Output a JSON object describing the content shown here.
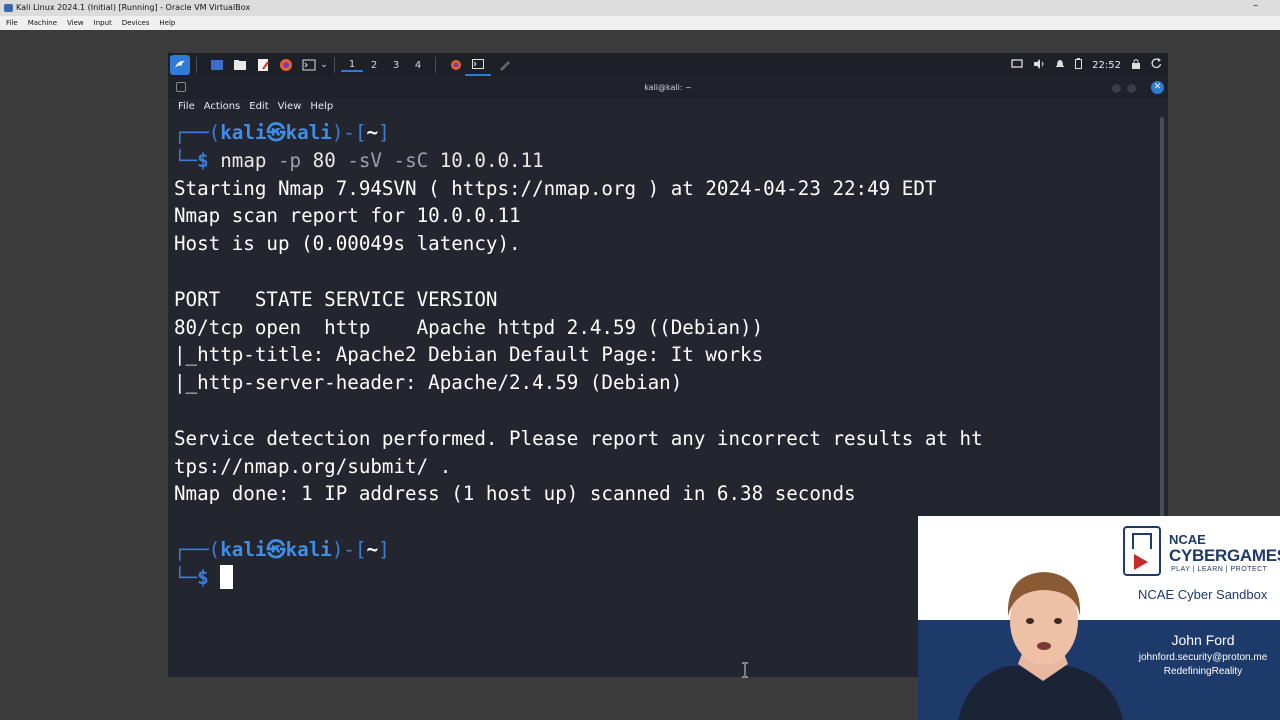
{
  "vbox": {
    "title": "Kali Linux 2024.1 (Initial) [Running] - Oracle VM VirtualBox",
    "menu": [
      "File",
      "Machine",
      "View",
      "Input",
      "Devices",
      "Help"
    ]
  },
  "panel": {
    "workspaces": [
      "1",
      "2",
      "3",
      "4"
    ],
    "active_workspace": "1",
    "clock": "22:52"
  },
  "terminal": {
    "title": "kali@kali: ~",
    "menu": [
      "File",
      "Actions",
      "Edit",
      "View",
      "Help"
    ],
    "prompt": {
      "user": "kali",
      "at": "㉿",
      "host": "kali",
      "dir": "~"
    },
    "command": {
      "bin": "nmap",
      "args": [
        " -p",
        " 80 ",
        "-sV",
        " -sC",
        " 10.0.0.11"
      ]
    },
    "output": [
      "Starting Nmap 7.94SVN ( https://nmap.org ) at 2024-04-23 22:49 EDT",
      "Nmap scan report for 10.0.0.11",
      "Host is up (0.00049s latency).",
      "",
      "PORT   STATE SERVICE VERSION",
      "80/tcp open  http    Apache httpd 2.4.59 ((Debian))",
      "|_http-title: Apache2 Debian Default Page: It works",
      "|_http-server-header: Apache/2.4.59 (Debian)",
      "",
      "Service detection performed. Please report any incorrect results at ht",
      "tps://nmap.org/submit/ .",
      "Nmap done: 1 IP address (1 host up) scanned in 6.38 seconds"
    ]
  },
  "presenter": {
    "logo_line1": "NCAE",
    "logo_line2": "CYBERGAMES",
    "logo_tagline": "PLAY | LEARN | PROTECT",
    "subtitle": "NCAE Cyber Sandbox",
    "name": "John Ford",
    "email": "johnford.security@proton.me",
    "channel": "RedefiningReality"
  },
  "colors": {
    "prompt_blue": "#3f8ee8",
    "terminal_bg": "#23262e",
    "panel_bg": "#1d2027",
    "brand_navy": "#1e3a6a",
    "play_red": "#c52b2b"
  }
}
